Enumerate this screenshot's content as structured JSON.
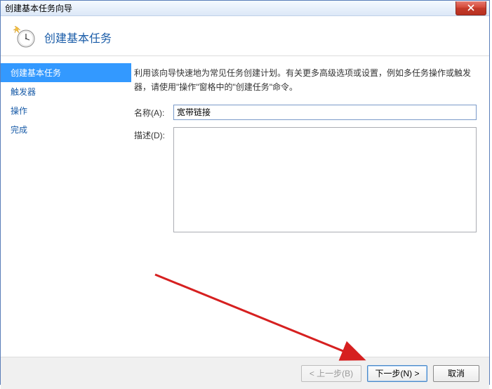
{
  "window": {
    "title": "创建基本任务向导"
  },
  "header": {
    "title": "创建基本任务"
  },
  "sidebar": {
    "items": [
      {
        "label": "创建基本任务",
        "selected": true
      },
      {
        "label": "触发器",
        "selected": false
      },
      {
        "label": "操作",
        "selected": false
      },
      {
        "label": "完成",
        "selected": false
      }
    ]
  },
  "content": {
    "intro": "利用该向导快速地为常见任务创建计划。有关更多高级选项或设置，例如多任务操作或触发器，请使用\"操作\"窗格中的\"创建任务\"命令。",
    "name_label": "名称(A):",
    "name_value": "宽带链接",
    "desc_label": "描述(D):",
    "desc_value": ""
  },
  "footer": {
    "back": "< 上一步(B)",
    "next": "下一步(N) >",
    "cancel": "取消"
  }
}
